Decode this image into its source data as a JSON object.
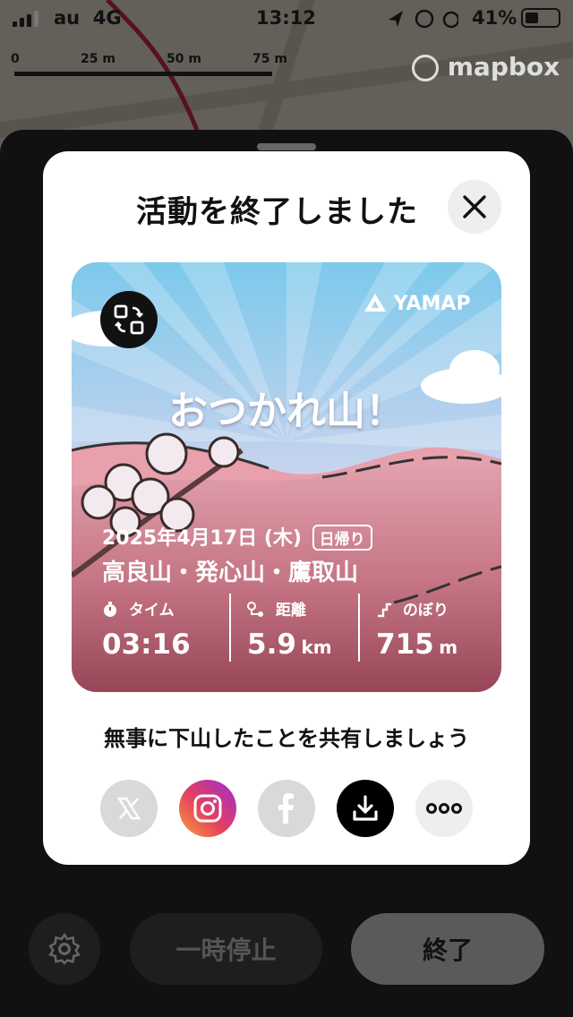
{
  "status_bar": {
    "carrier": "au",
    "network": "4G",
    "time": "13:12",
    "battery": "41%"
  },
  "map": {
    "scale_labels": [
      "0",
      "25 m",
      "50 m",
      "75 m"
    ],
    "attribution": "mapbox"
  },
  "controls": {
    "pause_label": "一時停止",
    "finish_label": "終了"
  },
  "modal": {
    "title": "活動を終了しました",
    "card": {
      "brand": "YAMAP",
      "headline": "おつかれ山！",
      "date": "2025年4月17日 (木)",
      "trip_type": "日帰り",
      "mountains": "高良山・発心山・鷹取山",
      "stats": {
        "time_label": "タイム",
        "time_value": "03:16",
        "distance_label": "距離",
        "distance_value": "5.9",
        "distance_unit": "km",
        "ascent_label": "のぼり",
        "ascent_value": "715",
        "ascent_unit": "m"
      }
    },
    "share_prompt": "無事に下山したことを共有しましょう"
  },
  "colors": {
    "sky_top": "#7cc9ec",
    "sky_bottom": "#f4d7e2",
    "card_bottom": "#9b4a5a",
    "pink_hill": "#e8a0ad"
  }
}
